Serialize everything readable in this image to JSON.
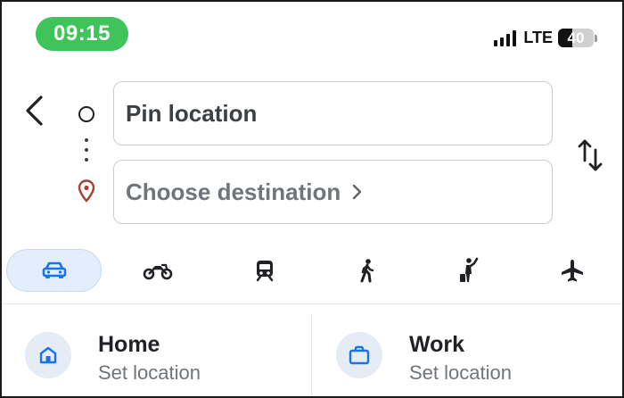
{
  "status_bar": {
    "time": "09:15",
    "network": "LTE",
    "battery": "40",
    "battery_level": 0.4,
    "time_pill_color": "#3ec45a"
  },
  "directions": {
    "origin": {
      "value": "Pin location"
    },
    "destination": {
      "placeholder": "Choose destination"
    }
  },
  "travel_modes": {
    "selected": "driving",
    "items": [
      {
        "mode": "driving",
        "icon": "car-icon"
      },
      {
        "mode": "two-wheeler",
        "icon": "motorcycle-icon"
      },
      {
        "mode": "transit",
        "icon": "train-icon"
      },
      {
        "mode": "walking",
        "icon": "walking-icon"
      },
      {
        "mode": "ride-services",
        "icon": "hail-icon"
      },
      {
        "mode": "flights",
        "icon": "plane-icon"
      }
    ]
  },
  "saved_places": [
    {
      "title": "Home",
      "subtitle": "Set location",
      "icon": "home-icon"
    },
    {
      "title": "Work",
      "subtitle": "Set location",
      "icon": "briefcase-icon"
    }
  ],
  "colors": {
    "accent": "#1a73e8",
    "active_mode_background": "#e3edfb",
    "place_icon_background": "#e5ecf5",
    "destination_pin": "#a93f32"
  }
}
